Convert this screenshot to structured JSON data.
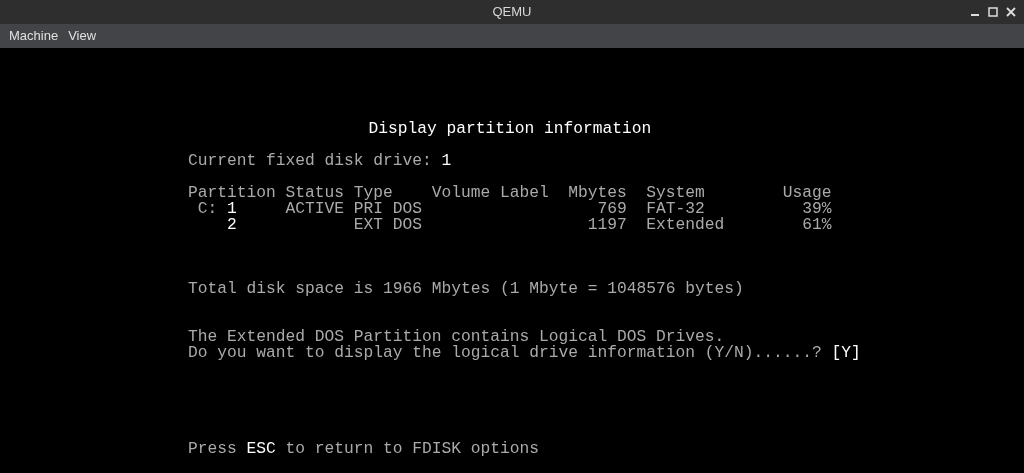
{
  "window": {
    "title": "QEMU"
  },
  "menu": [
    "Machine",
    "View"
  ],
  "screen": {
    "title": "Display partition information",
    "current_drive": "Current fixed disk drive: **1**",
    "table": {
      "columns": [
        "Partition",
        "Status",
        "Type",
        "Volume Label",
        "Mbytes",
        "System",
        "Usage"
      ],
      "rows": [
        {
          "drive": "C:",
          "number": "1",
          "status": "ACTIVE",
          "type": "PRI DOS",
          "volume_label": "",
          "mbytes": "769",
          "system": "FAT-32",
          "usage": "39%"
        },
        {
          "number": "2",
          "status": "",
          "type": "EXT DOS",
          "volume_label": "",
          "mbytes": "1197",
          "system": "Extended",
          "usage": "61%"
        }
      ]
    },
    "total": "Total disk space is 1966 Mbytes (1 Mbyte = 1048576 bytes)",
    "messages": [
      "The Extended DOS Partition contains Logical DOS Drives.",
      "Do you want to display the logical drive information (Y/N)......? **[Y]**"
    ],
    "footer": "Press **ESC** to return to FDISK options"
  }
}
